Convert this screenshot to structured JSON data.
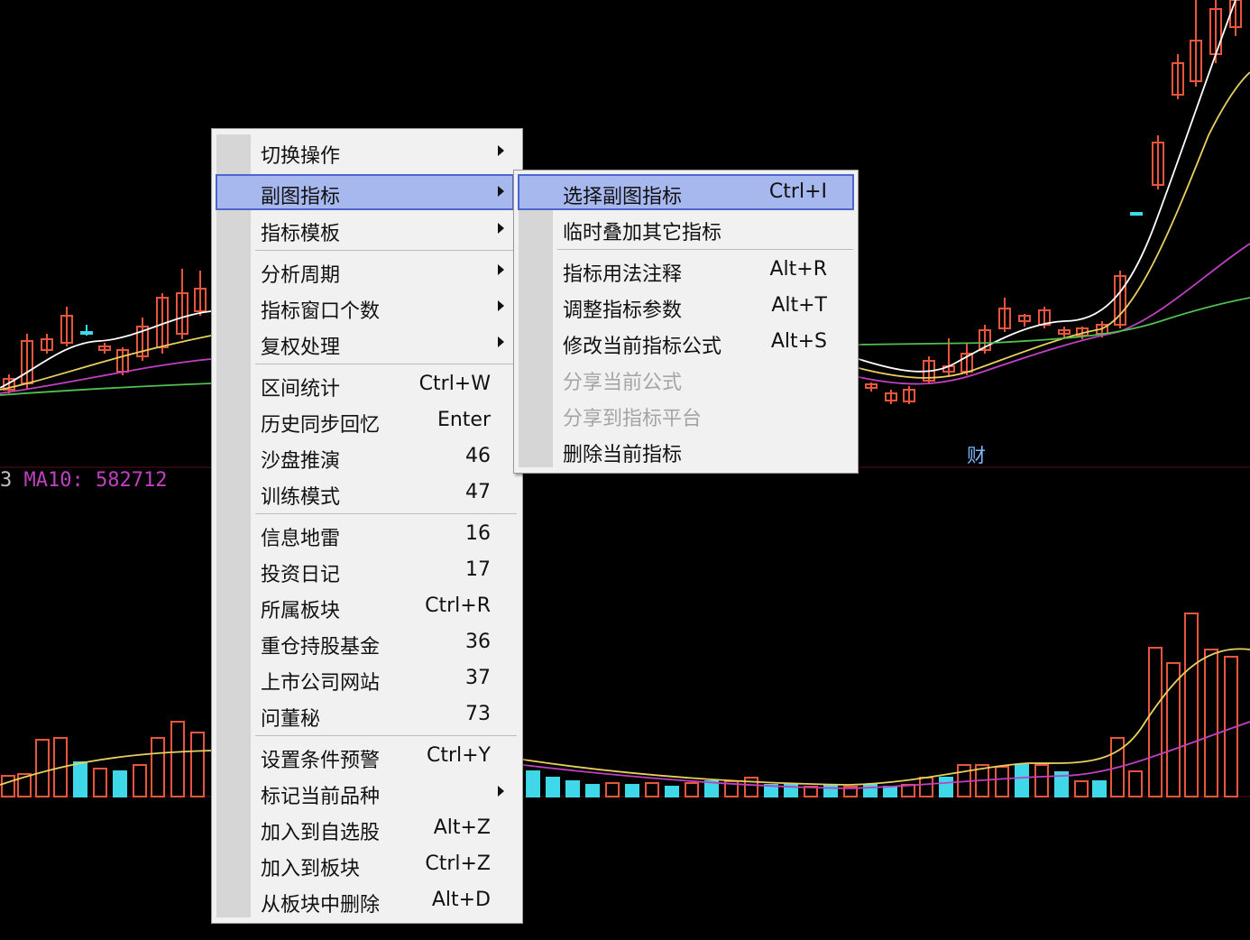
{
  "indicator": {
    "prefix": "3",
    "text": "MA10: 582712",
    "color": "#c040c0"
  },
  "chart_marker": "财",
  "main_menu": {
    "items": [
      {
        "label": "切换操作",
        "shortcut": "",
        "submenu": true
      },
      {
        "label": "副图指标",
        "shortcut": "",
        "submenu": true,
        "highlighted": true
      },
      {
        "label": "指标模板",
        "shortcut": "",
        "submenu": true
      },
      {
        "label": "分析周期",
        "shortcut": "",
        "submenu": true,
        "sep_before": true
      },
      {
        "label": "指标窗口个数",
        "shortcut": "",
        "submenu": true
      },
      {
        "label": "复权处理",
        "shortcut": "",
        "submenu": true
      },
      {
        "label": "区间统计",
        "shortcut": "Ctrl+W",
        "sep_before": true
      },
      {
        "label": "历史同步回忆",
        "shortcut": "Enter"
      },
      {
        "label": "沙盘推演",
        "shortcut": "46"
      },
      {
        "label": "训练模式",
        "shortcut": "47"
      },
      {
        "label": "信息地雷",
        "shortcut": "16",
        "sep_before": true
      },
      {
        "label": "投资日记",
        "shortcut": "17"
      },
      {
        "label": "所属板块",
        "shortcut": "Ctrl+R"
      },
      {
        "label": "重仓持股基金",
        "shortcut": "36"
      },
      {
        "label": "上市公司网站",
        "shortcut": "37"
      },
      {
        "label": "问董秘",
        "shortcut": "73"
      },
      {
        "label": "设置条件预警",
        "shortcut": "Ctrl+Y",
        "sep_before": true
      },
      {
        "label": "标记当前品种",
        "shortcut": "",
        "submenu": true
      },
      {
        "label": "加入到自选股",
        "shortcut": "Alt+Z"
      },
      {
        "label": "加入到板块",
        "shortcut": "Ctrl+Z"
      },
      {
        "label": "从板块中删除",
        "shortcut": "Alt+D"
      }
    ]
  },
  "sub_menu": {
    "items": [
      {
        "label": "选择副图指标",
        "shortcut": "Ctrl+I",
        "highlighted": true
      },
      {
        "label": "临时叠加其它指标",
        "shortcut": ""
      },
      {
        "label": "指标用法注释",
        "shortcut": "Alt+R",
        "sep_before": true
      },
      {
        "label": "调整指标参数",
        "shortcut": "Alt+T"
      },
      {
        "label": "修改当前指标公式",
        "shortcut": "Alt+S"
      },
      {
        "label": "分享当前公式",
        "shortcut": "",
        "disabled": true
      },
      {
        "label": "分享到指标平台",
        "shortcut": "",
        "disabled": true
      },
      {
        "label": "删除当前指标",
        "shortcut": ""
      }
    ]
  },
  "colors": {
    "up": "#e8553a",
    "down": "#3fd8e8",
    "ma_white": "#ffffff",
    "ma_yellow": "#e8d060",
    "ma_magenta": "#c040c0",
    "ma_green": "#50c050",
    "menu_highlight": "#a7b8ee"
  }
}
